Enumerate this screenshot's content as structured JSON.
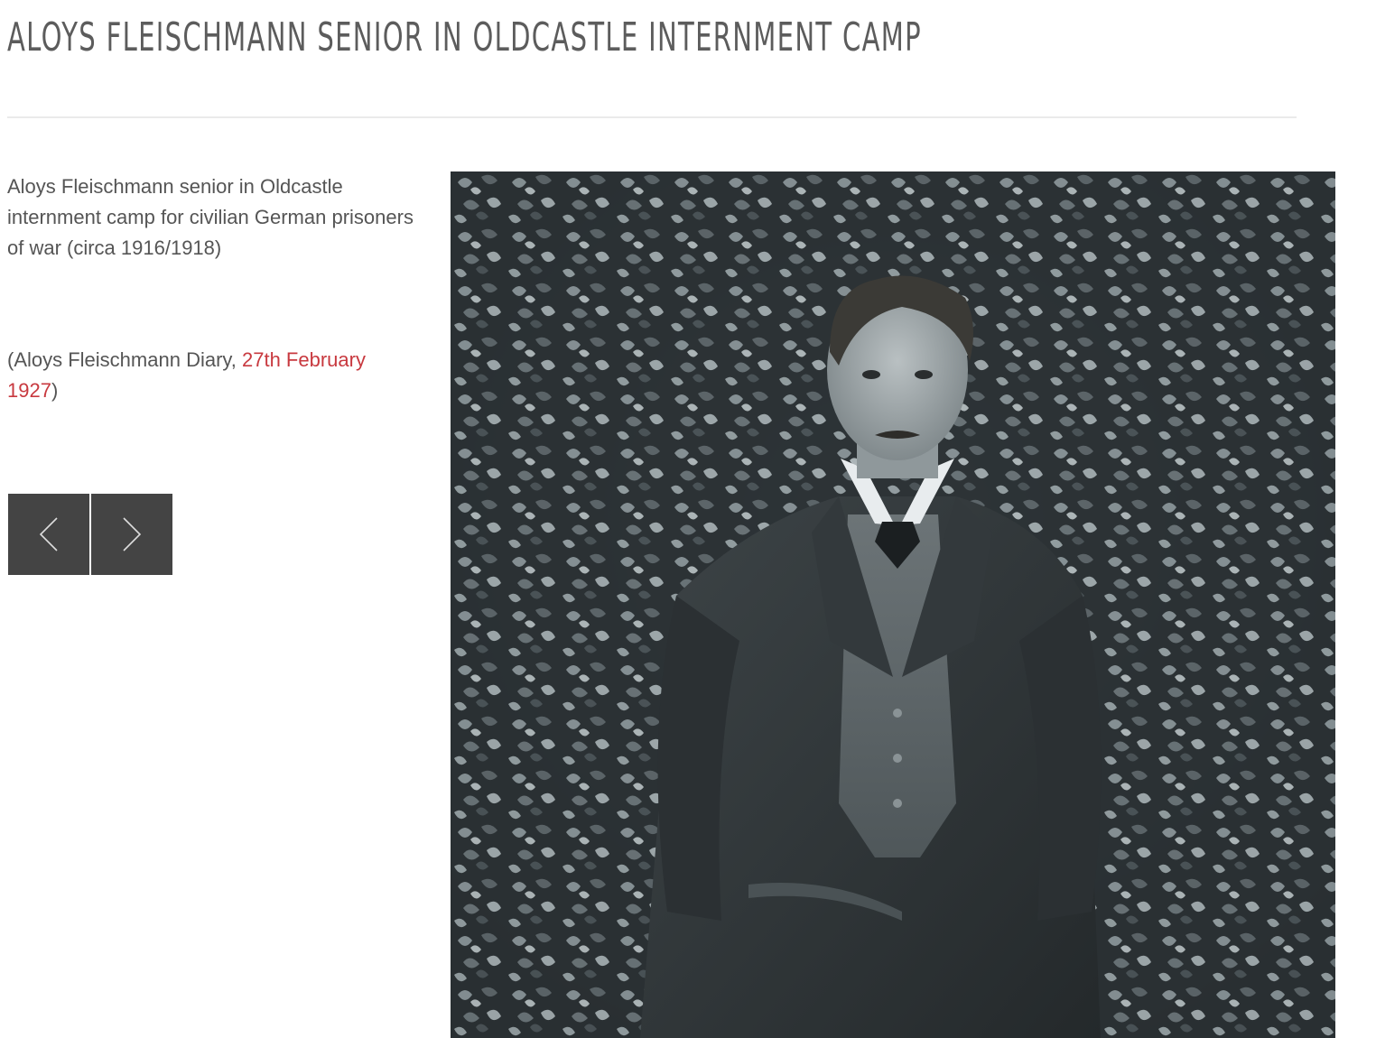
{
  "page": {
    "title": "ALOYS FLEISCHMANN SENIOR IN OLDCASTLE INTERNMENT CAMP"
  },
  "caption": {
    "text": "Aloys Fleischmann senior in Oldcastle internment camp for civilian German prisoners of war (circa 1916/1918)"
  },
  "source": {
    "prefix": "(Aloys Fleischmann Diary, ",
    "link_text": "27th February 1927",
    "suffix": ")"
  },
  "navigation": {
    "prev_icon": "chevron-left-icon",
    "next_icon": "chevron-right-icon"
  },
  "photo": {
    "subject": "photograph"
  },
  "colors": {
    "title": "#5c5c5c",
    "body_text": "#555555",
    "link": "#c8393f",
    "nav_button_bg": "#444444",
    "rule": "#eaeaea"
  }
}
